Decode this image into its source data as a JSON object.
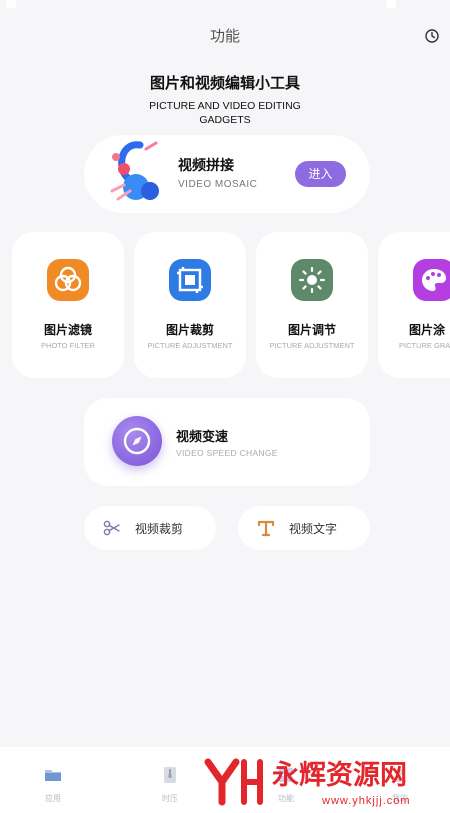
{
  "header": {
    "title": "功能",
    "history_icon": "clock-icon"
  },
  "hero": {
    "title_cn": "图片和视频编辑小工具",
    "title_en_line1": "PICTURE AND VIDEO EDITING",
    "title_en_line2": "GADGETS"
  },
  "mosaic": {
    "name": "视频拼接",
    "subtitle": "VIDEO MOSAIC",
    "button": "进入",
    "button_color": "#8d6be0"
  },
  "tools": [
    {
      "name": "图片滤镜",
      "subtitle": "PHOTO FILTER",
      "icon": "filter-circles-icon",
      "color": "#f08a24"
    },
    {
      "name": "图片裁剪",
      "subtitle": "PICTURE ADJUSTMENT",
      "icon": "crop-frame-icon",
      "color": "#2f7be6"
    },
    {
      "name": "图片调节",
      "subtitle": "PICTURE ADJUSTMENT",
      "icon": "sun-icon",
      "color": "#5e8a6a"
    },
    {
      "name": "图片涂",
      "subtitle": "PICTURE GRA",
      "icon": "palette-icon",
      "color": "#b43ee0"
    }
  ],
  "speed": {
    "name": "视频变速",
    "subtitle": "VIDEO SPEED CHANGE",
    "icon": "compass-icon"
  },
  "pills": [
    {
      "name": "视频裁剪",
      "icon": "scissors-icon"
    },
    {
      "name": "视频文字",
      "icon": "text-t-icon"
    }
  ],
  "tabbar": {
    "items": [
      {
        "label": "应用",
        "icon": "folder-icon"
      },
      {
        "label": "时压",
        "icon": "file-zip-icon"
      },
      {
        "label": "功能",
        "icon": "grid-icon"
      },
      {
        "label": "我的",
        "icon": "user-icon"
      }
    ]
  },
  "watermark": {
    "text_cn": "永辉资源网",
    "url": "www.yhkjjj.com",
    "logo": "YH"
  }
}
